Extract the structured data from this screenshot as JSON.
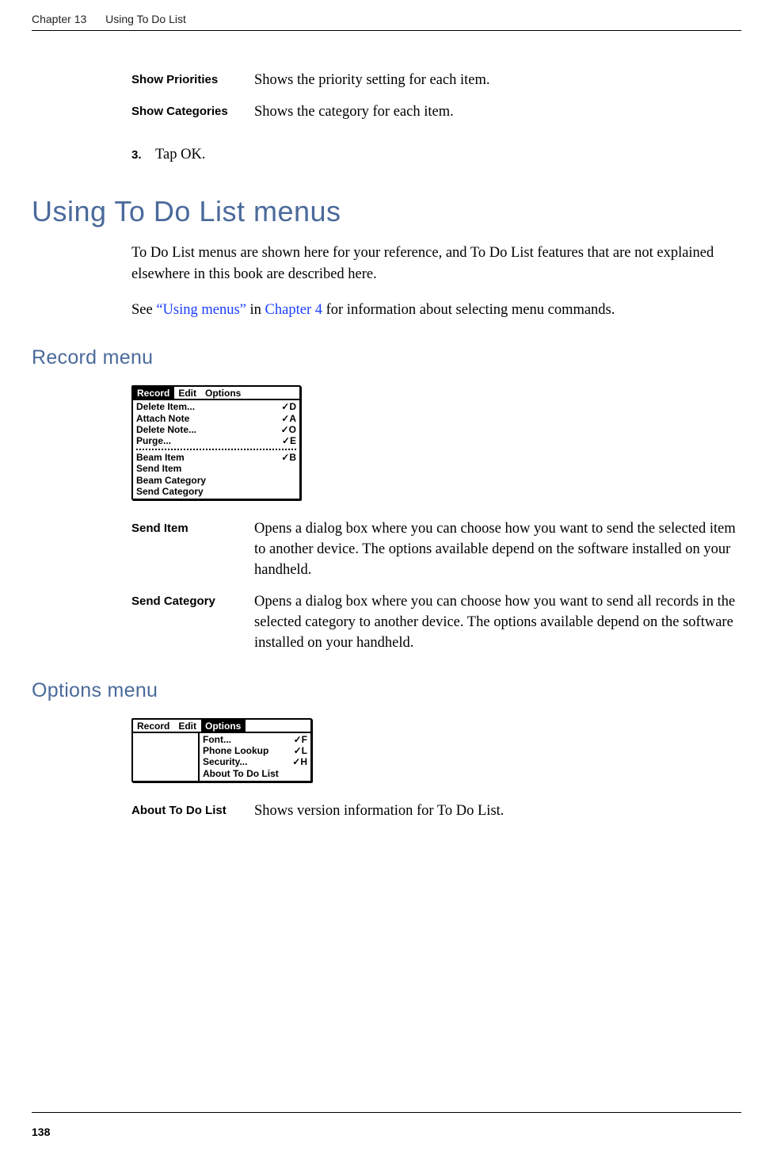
{
  "header": {
    "chapter": "Chapter 13",
    "title": "Using To Do List"
  },
  "top_defs": [
    {
      "label": "Show Priorities",
      "desc": "Shows the priority setting for each item."
    },
    {
      "label": "Show Categories",
      "desc": "Shows the category for each item."
    }
  ],
  "step": {
    "num": "3.",
    "text": "Tap OK."
  },
  "h1": "Using To Do List menus",
  "para1_a": "To Do List menus are shown here for your reference, and To Do List features that are not explained elsewhere in this book are described here.",
  "para2_prefix": "See ",
  "para2_link1": "“Using menus”",
  "para2_mid": " in ",
  "para2_link2": "Chapter 4",
  "para2_suffix": " for information about selecting menu commands.",
  "record": {
    "heading": "Record menu",
    "tabs": [
      "Record",
      "Edit",
      "Options"
    ],
    "group1": [
      {
        "l": "Delete Item...",
        "s": "✓D"
      },
      {
        "l": "Attach Note",
        "s": "✓A"
      },
      {
        "l": "Delete Note...",
        "s": "✓O"
      },
      {
        "l": "Purge...",
        "s": "✓E"
      }
    ],
    "group2": [
      {
        "l": "Beam Item",
        "s": "✓B"
      },
      {
        "l": "Send Item",
        "s": ""
      },
      {
        "l": "Beam Category",
        "s": ""
      },
      {
        "l": "Send Category",
        "s": ""
      }
    ],
    "defs": [
      {
        "label": "Send Item",
        "desc": "Opens a dialog box where you can choose how you want to send the selected item to another device. The options available depend on the software installed on your handheld."
      },
      {
        "label": "Send Category",
        "desc": "Opens a dialog box where you can choose how you want to send all records in the selected category to another device. The options available depend on the software installed on your handheld."
      }
    ]
  },
  "options": {
    "heading": "Options menu",
    "tabs": [
      "Record",
      "Edit",
      "Options"
    ],
    "items": [
      {
        "l": "Font...",
        "s": "✓F"
      },
      {
        "l": "Phone Lookup",
        "s": "✓L"
      },
      {
        "l": "Security...",
        "s": "✓H"
      },
      {
        "l": "About To Do List",
        "s": ""
      }
    ],
    "defs": [
      {
        "label": "About To Do List",
        "desc": "Shows version information for To Do List."
      }
    ]
  },
  "page_num": "138"
}
